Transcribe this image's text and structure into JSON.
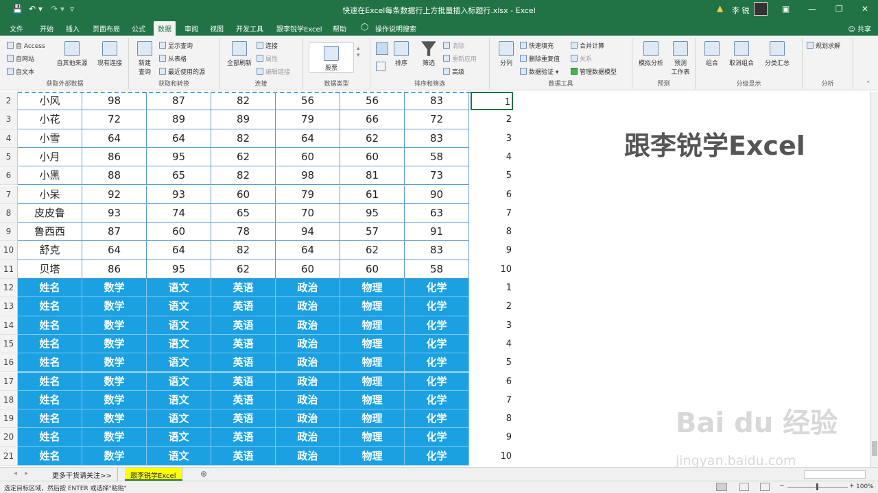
{
  "titlebar": {
    "title": "快速在Excel每条数据行上方批量插入标题行.xlsx - Excel",
    "user": "李 锐",
    "save_icon": "save-icon",
    "undo_icon": "undo-icon",
    "redo_icon": "redo-icon"
  },
  "menu": {
    "tabs": [
      "文件",
      "开始",
      "插入",
      "页面布局",
      "公式",
      "数据",
      "审阅",
      "视图",
      "开发工具",
      "跟李锐学Excel",
      "帮助",
      "操作说明搜索"
    ],
    "active": "数据",
    "share": "共享"
  },
  "ribbon": {
    "groups": {
      "get_external": {
        "label": "获取外部数据",
        "access": "自 Access",
        "web": "自网站",
        "text": "自文本",
        "other": "自其他来源",
        "existing": "现有连接"
      },
      "get_transform": {
        "label": "获取和转换",
        "new_query": "新建\n查询",
        "show_query": "显示查询",
        "from_table": "从表格",
        "recent": "最近使用的源"
      },
      "connections": {
        "label": "连接",
        "refresh": "全部刷新",
        "conn": "连接",
        "props": "属性",
        "edit_links": "编辑链接"
      },
      "data_types": {
        "label": "数据类型",
        "stocks": "股票"
      },
      "sort_filter": {
        "label": "排序和筛选",
        "sort": "排序",
        "filter": "筛选",
        "clear": "清除",
        "reapply": "重新应用",
        "advanced": "高级"
      },
      "data_tools": {
        "label": "数据工具",
        "split": "分列",
        "flash": "快速填充",
        "dedupe": "删除重复值",
        "validate": "数据验证",
        "consolidate": "合并计算",
        "relations": "关系",
        "model": "管理数据模型"
      },
      "forecast": {
        "label": "预测",
        "whatif": "模拟分析",
        "sheet": "预测\n工作表"
      },
      "outline": {
        "label": "分级显示",
        "group": "组合",
        "ungroup": "取消组合",
        "subtotal": "分类汇总"
      },
      "analysis": {
        "label": "分析",
        "solver": "规划求解"
      }
    }
  },
  "grid": {
    "data_rows": [
      {
        "r": "2",
        "name": "小风",
        "v": [
          "98",
          "87",
          "82",
          "56",
          "56",
          "83"
        ],
        "n": "1"
      },
      {
        "r": "3",
        "name": "小花",
        "v": [
          "72",
          "89",
          "89",
          "79",
          "66",
          "72"
        ],
        "n": "2"
      },
      {
        "r": "4",
        "name": "小雪",
        "v": [
          "64",
          "64",
          "82",
          "64",
          "62",
          "83"
        ],
        "n": "3"
      },
      {
        "r": "5",
        "name": "小月",
        "v": [
          "86",
          "95",
          "62",
          "60",
          "60",
          "58"
        ],
        "n": "4"
      },
      {
        "r": "6",
        "name": "小黑",
        "v": [
          "88",
          "65",
          "82",
          "98",
          "81",
          "73"
        ],
        "n": "5"
      },
      {
        "r": "7",
        "name": "小呆",
        "v": [
          "92",
          "93",
          "60",
          "79",
          "61",
          "90"
        ],
        "n": "6"
      },
      {
        "r": "8",
        "name": "皮皮鲁",
        "v": [
          "93",
          "74",
          "65",
          "70",
          "95",
          "63"
        ],
        "n": "7"
      },
      {
        "r": "9",
        "name": "鲁西西",
        "v": [
          "87",
          "60",
          "78",
          "94",
          "57",
          "91"
        ],
        "n": "8"
      },
      {
        "r": "10",
        "name": "舒克",
        "v": [
          "64",
          "64",
          "82",
          "64",
          "62",
          "83"
        ],
        "n": "9"
      },
      {
        "r": "11",
        "name": "贝塔",
        "v": [
          "86",
          "95",
          "62",
          "60",
          "60",
          "58"
        ],
        "n": "10"
      }
    ],
    "header_cells": [
      "姓名",
      "数学",
      "语文",
      "英语",
      "政治",
      "物理",
      "化学"
    ],
    "header_rows": [
      {
        "r": "12",
        "n": "1"
      },
      {
        "r": "13",
        "n": "2"
      },
      {
        "r": "14",
        "n": "3"
      },
      {
        "r": "15",
        "n": "4"
      },
      {
        "r": "16",
        "n": "5"
      },
      {
        "r": "17",
        "n": "6"
      },
      {
        "r": "18",
        "n": "7"
      },
      {
        "r": "19",
        "n": "8"
      },
      {
        "r": "20",
        "n": "9"
      },
      {
        "r": "21",
        "n": "10"
      }
    ]
  },
  "overlay": {
    "title": "跟李锐学Excel",
    "watermark": "Bai du 经验",
    "watermark_url": "jingyan.baidu.com"
  },
  "sheets": {
    "tabs": [
      "更多干货请关注>>",
      "跟李锐学Excel"
    ],
    "active": "跟李锐学Excel",
    "active_color": "#ffff00"
  },
  "status": {
    "message": "选定目标区域，然后按 ENTER 或选择\"粘贴\"",
    "zoom": "100%"
  },
  "colors": {
    "brand": "#217346",
    "header_fill": "#1ba1e2"
  }
}
